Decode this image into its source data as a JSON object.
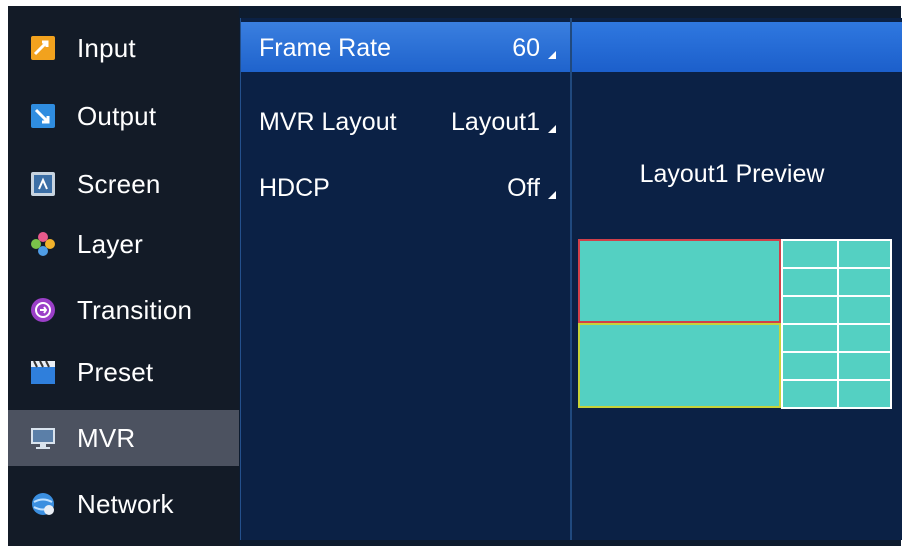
{
  "sidebar": {
    "items": [
      {
        "label": "Input",
        "icon": "input-icon"
      },
      {
        "label": "Output",
        "icon": "output-icon"
      },
      {
        "label": "Screen",
        "icon": "screen-icon"
      },
      {
        "label": "Layer",
        "icon": "layer-icon"
      },
      {
        "label": "Transition",
        "icon": "transition-icon"
      },
      {
        "label": "Preset",
        "icon": "preset-icon"
      },
      {
        "label": "MVR",
        "icon": "mvr-icon",
        "active": true
      },
      {
        "label": "Network",
        "icon": "network-icon"
      }
    ]
  },
  "settings": {
    "rows": [
      {
        "label": "Frame Rate",
        "value": "60",
        "selected": true
      },
      {
        "label": "MVR Layout",
        "value": "Layout1"
      },
      {
        "label": "HDCP",
        "value": "Off"
      }
    ]
  },
  "preview": {
    "title": "Layout1 Preview"
  },
  "colors": {
    "accent": "#2a6fdc",
    "panel": "#0b2145",
    "pane_fill": "#54d0c2",
    "pgm_border": "#d0404a",
    "pvw_border": "#c6d33a"
  }
}
